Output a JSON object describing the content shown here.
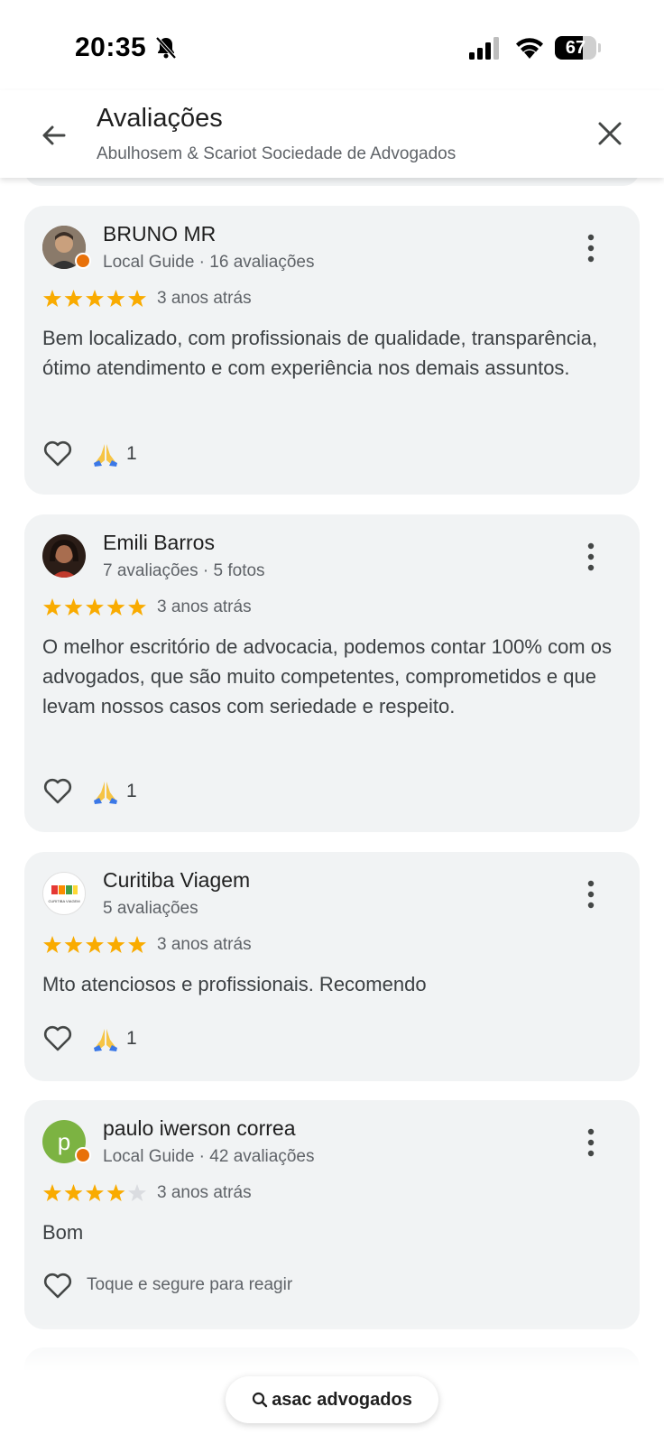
{
  "status_bar": {
    "time": "20:35",
    "battery": "67",
    "battery_level": 0.67
  },
  "header": {
    "title": "Avaliações",
    "subtitle": "Abulhosem & Scariot Sociedade de Advogados"
  },
  "reviews": [
    {
      "name": "BRUNO MR",
      "meta": "Local Guide · 16 avaliações",
      "rating": 5,
      "date": "3 anos atrás",
      "text": "Bem localizado, com profissionais de qualidade, transparência, ótimo atendimento e com experiência nos demais assuntos.",
      "reaction_count": "1"
    },
    {
      "name": "Emili Barros",
      "meta": "7 avaliações · 5 fotos",
      "rating": 5,
      "date": "3 anos atrás",
      "text": "O melhor escritório de advocacia, podemos contar 100% com os advogados, que são muito competentes, comprometidos e que levam nossos casos com seriedade e respeito.",
      "reaction_count": "1"
    },
    {
      "name": "Curitiba Viagem",
      "meta": "5 avaliações",
      "rating": 5,
      "date": "3 anos atrás",
      "text": "Mto atenciosos e profissionais. Recomendo",
      "reaction_count": "1",
      "avatar_caption": "CURITIBA VIAGEM"
    },
    {
      "name": "paulo iwerson correa",
      "meta": "Local Guide · 42 avaliações",
      "rating": 4,
      "date": "3 anos atrás",
      "text": "Bom",
      "react_hint": "Toque e segure para reagir",
      "avatar_letter": "p"
    }
  ],
  "search": {
    "label": "asac advogados"
  },
  "colors": {
    "star": "#f9ab00",
    "star_empty": "#dadce0",
    "card": "#f1f3f4",
    "badge": "#e8710a",
    "avatar_green": "#7cb342"
  }
}
